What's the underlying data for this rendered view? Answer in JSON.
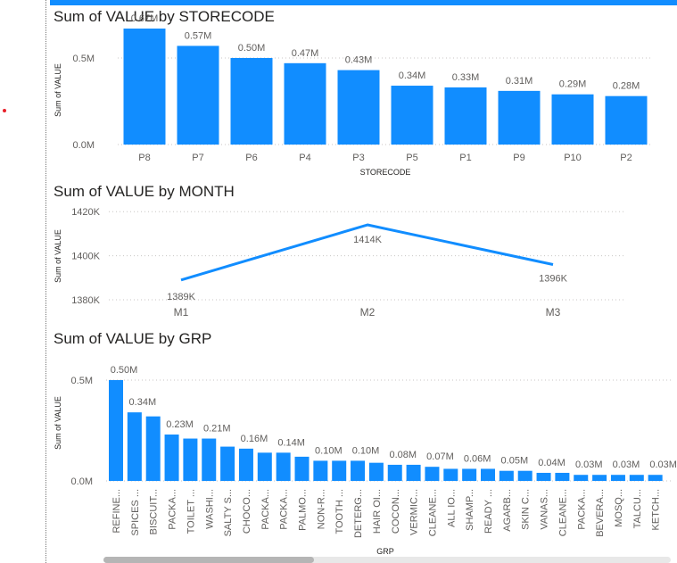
{
  "colors": {
    "accent": "#118dff",
    "text": "#252423",
    "axis": "#605e5c"
  },
  "chart_data": [
    {
      "type": "bar",
      "title": "Sum of VALUE by STORECODE",
      "xlabel": "STORECODE",
      "ylabel": "Sum of VALUE",
      "ylim": [
        0,
        0.72
      ],
      "yticks": [
        0,
        0.5
      ],
      "ytick_labels": [
        "0.0M",
        "0.5M"
      ],
      "categories": [
        "P8",
        "P7",
        "P6",
        "P4",
        "P3",
        "P5",
        "P1",
        "P9",
        "P10",
        "P2"
      ],
      "values": [
        0.67,
        0.57,
        0.5,
        0.47,
        0.43,
        0.34,
        0.33,
        0.31,
        0.29,
        0.28
      ],
      "labels": [
        "0.67M",
        "0.57M",
        "0.50M",
        "0.47M",
        "0.43M",
        "0.34M",
        "0.33M",
        "0.31M",
        "0.29M",
        "0.28M"
      ],
      "grid": true
    },
    {
      "type": "line",
      "title": "Sum of VALUE by MONTH",
      "xlabel": "",
      "ylabel": "Sum of VALUE",
      "ylim": [
        1380,
        1420
      ],
      "yticks": [
        1380,
        1400,
        1420
      ],
      "ytick_labels": [
        "1380K",
        "1400K",
        "1420K"
      ],
      "categories": [
        "M1",
        "M2",
        "M3"
      ],
      "values": [
        1389,
        1414,
        1396
      ],
      "labels": [
        "1389K",
        "1414K",
        "1396K"
      ],
      "grid": true
    },
    {
      "type": "bar",
      "title": "Sum of VALUE by GRP",
      "xlabel": "GRP",
      "ylabel": "Sum of VALUE",
      "ylim": [
        0,
        0.58
      ],
      "yticks": [
        0,
        0.5
      ],
      "ytick_labels": [
        "0.0M",
        "0.5M"
      ],
      "categories": [
        "REFINE...",
        "SPICES ...",
        "BISCUIT...",
        "PACKA...",
        "TOILET ...",
        "WASHI...",
        "SALTY S...",
        "CHOCO...",
        "PACKA...",
        "PACKA...",
        "PALMO...",
        "NON-R...",
        "TOOTH ...",
        "DETERG...",
        "HAIR OI...",
        "COCON...",
        "VERMIC...",
        "CLEANE...",
        "ALL IO...",
        "SHAMP...",
        "READY ...",
        "AGARB...",
        "SKIN C...",
        "VANAS...",
        "CLEANE...",
        "PACKA...",
        "BEVERA...",
        "MOSQ...",
        "TALCU...",
        "KETCH..."
      ],
      "values": [
        0.5,
        0.34,
        0.32,
        0.23,
        0.21,
        0.21,
        0.17,
        0.16,
        0.14,
        0.14,
        0.12,
        0.1,
        0.1,
        0.1,
        0.09,
        0.08,
        0.08,
        0.07,
        0.06,
        0.06,
        0.06,
        0.05,
        0.05,
        0.04,
        0.04,
        0.03,
        0.03,
        0.03,
        0.03,
        0.03
      ],
      "labels": [
        "0.50M",
        "0.34M",
        "",
        "0.23M",
        "",
        "0.21M",
        "",
        "0.16M",
        "",
        "0.14M",
        "",
        "0.10M",
        "",
        "0.10M",
        "",
        "0.08M",
        "",
        "0.07M",
        "",
        "0.06M",
        "",
        "0.05M",
        "",
        "0.04M",
        "",
        "0.03M",
        "",
        "0.03M",
        "",
        "0.03M"
      ],
      "grid": true
    }
  ]
}
